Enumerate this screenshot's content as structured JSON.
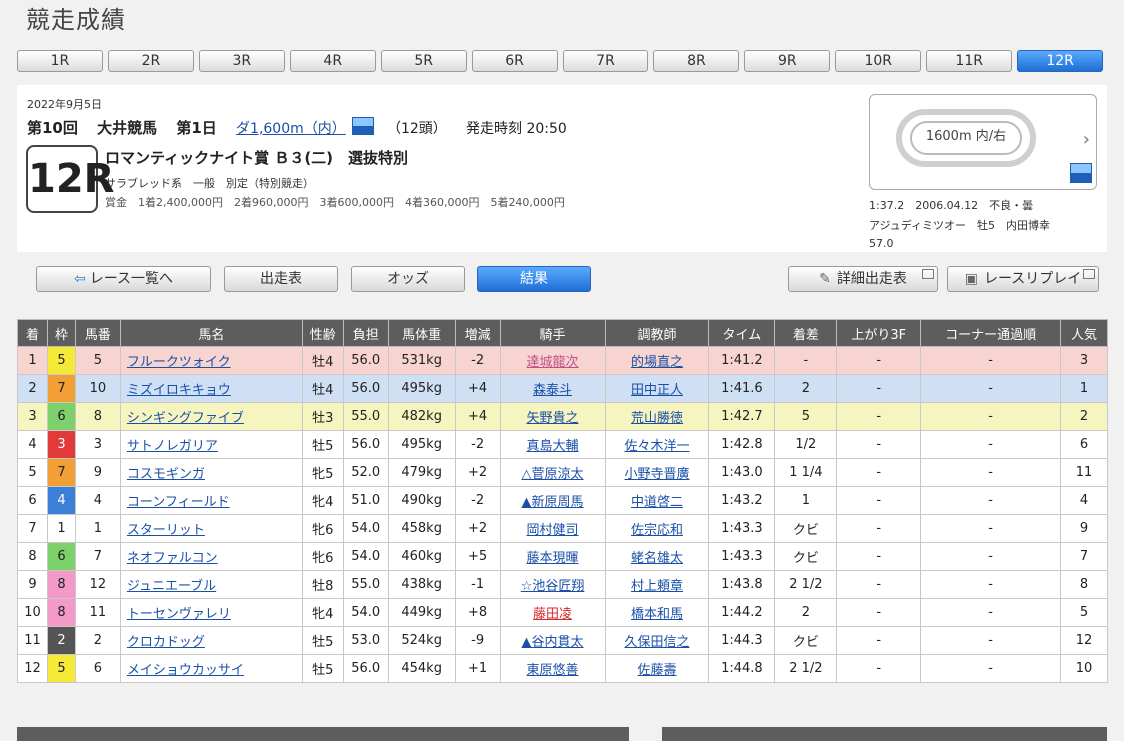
{
  "page": {
    "title": "競走成績"
  },
  "race_tabs": [
    "1R",
    "2R",
    "3R",
    "4R",
    "5R",
    "6R",
    "7R",
    "8R",
    "9R",
    "10R",
    "11R",
    "12R"
  ],
  "active_tab": "12R",
  "race": {
    "date": "2022年9月5日",
    "kai": "第10回",
    "venue": "大井競馬",
    "day": "第1日",
    "distance": "ダ1,600m（内）",
    "heads": "（12頭）",
    "start_time": "発走時刻 20:50",
    "badge": "12R",
    "name": "ロマンティックナイト賞 Ｂ３(二)　選抜特別",
    "conditions": "サラブレッド系　一般　別定（特別競走）",
    "prize": "賞金　1着2,400,000円　2着960,000円　3着600,000円　4着360,000円　5着240,000円"
  },
  "track": {
    "label": "1600m 内/右",
    "record_line1": "1:37.2　2006.04.12　不良・曇",
    "record_line2": "アジュディミツオー　牡5　内田博幸",
    "record_line3": "57.0"
  },
  "buttons": {
    "race_list": "レース一覧へ",
    "entries": "出走表",
    "odds": "オッズ",
    "result": "結果",
    "detail_entries": "詳細出走表",
    "replay": "レースリプレイ"
  },
  "table": {
    "headers": [
      "着",
      "枠",
      "馬番",
      "馬名",
      "性齢",
      "負担",
      "馬体重",
      "増減",
      "騎手",
      "調教師",
      "タイム",
      "着差",
      "上がり3F",
      "コーナー通過順",
      "人気"
    ],
    "rows": [
      {
        "pos": "1",
        "waku": "5",
        "num": "5",
        "horse": "フルークツォイク",
        "sex_age": "牡4",
        "weight": "56.0",
        "body": "531kg",
        "diff": "-2",
        "jockey": "達城龍次",
        "trainer": "的場直之",
        "time": "1:41.2",
        "margin": "-",
        "last3f": "-",
        "corner": "-",
        "pop": "3"
      },
      {
        "pos": "2",
        "waku": "7",
        "num": "10",
        "horse": "ミズイロキキョウ",
        "sex_age": "牡4",
        "weight": "56.0",
        "body": "495kg",
        "diff": "+4",
        "jockey": "森泰斗",
        "trainer": "田中正人",
        "time": "1:41.6",
        "margin": "2",
        "last3f": "-",
        "corner": "-",
        "pop": "1"
      },
      {
        "pos": "3",
        "waku": "6",
        "num": "8",
        "horse": "シンギングファイブ",
        "sex_age": "牡3",
        "weight": "55.0",
        "body": "482kg",
        "diff": "+4",
        "jockey": "矢野貴之",
        "trainer": "荒山勝徳",
        "time": "1:42.7",
        "margin": "5",
        "last3f": "-",
        "corner": "-",
        "pop": "2"
      },
      {
        "pos": "4",
        "waku": "3",
        "num": "3",
        "horse": "サトノレガリア",
        "sex_age": "牡5",
        "weight": "56.0",
        "body": "495kg",
        "diff": "-2",
        "jockey": "真島大輔",
        "trainer": "佐々木洋一",
        "time": "1:42.8",
        "margin": "1/2",
        "last3f": "-",
        "corner": "-",
        "pop": "6"
      },
      {
        "pos": "5",
        "waku": "7",
        "num": "9",
        "horse": "コスモギンガ",
        "sex_age": "牝5",
        "weight": "52.0",
        "body": "479kg",
        "diff": "+2",
        "jockey": "△菅原涼太",
        "trainer": "小野寺晋廣",
        "time": "1:43.0",
        "margin": "1 1/4",
        "last3f": "-",
        "corner": "-",
        "pop": "11"
      },
      {
        "pos": "6",
        "waku": "4",
        "num": "4",
        "horse": "コーンフィールド",
        "sex_age": "牝4",
        "weight": "51.0",
        "body": "490kg",
        "diff": "-2",
        "jockey": "▲新原周馬",
        "trainer": "中道啓二",
        "time": "1:43.2",
        "margin": "1",
        "last3f": "-",
        "corner": "-",
        "pop": "4"
      },
      {
        "pos": "7",
        "waku": "1",
        "num": "1",
        "horse": "スターリット",
        "sex_age": "牝6",
        "weight": "54.0",
        "body": "458kg",
        "diff": "+2",
        "jockey": "岡村健司",
        "trainer": "佐宗応和",
        "time": "1:43.3",
        "margin": "クビ",
        "last3f": "-",
        "corner": "-",
        "pop": "9"
      },
      {
        "pos": "8",
        "waku": "6",
        "num": "7",
        "horse": "ネオファルコン",
        "sex_age": "牝6",
        "weight": "54.0",
        "body": "460kg",
        "diff": "+5",
        "jockey": "藤本現暉",
        "trainer": "蛯名雄太",
        "time": "1:43.3",
        "margin": "クビ",
        "last3f": "-",
        "corner": "-",
        "pop": "7"
      },
      {
        "pos": "9",
        "waku": "8",
        "num": "12",
        "horse": "ジュニエーブル",
        "sex_age": "牡8",
        "weight": "55.0",
        "body": "438kg",
        "diff": "-1",
        "jockey": "☆池谷匠翔",
        "trainer": "村上頼章",
        "time": "1:43.8",
        "margin": "2 1/2",
        "last3f": "-",
        "corner": "-",
        "pop": "8"
      },
      {
        "pos": "10",
        "waku": "8",
        "num": "11",
        "horse": "トーセンヴァレリ",
        "sex_age": "牝4",
        "weight": "54.0",
        "body": "449kg",
        "diff": "+8",
        "jockey": "藤田凌",
        "trainer": "橋本和馬",
        "time": "1:44.2",
        "margin": "2",
        "last3f": "-",
        "corner": "-",
        "pop": "5"
      },
      {
        "pos": "11",
        "waku": "2",
        "num": "2",
        "horse": "クロカドッグ",
        "sex_age": "牡5",
        "weight": "53.0",
        "body": "524kg",
        "diff": "-9",
        "jockey": "▲谷内貫太",
        "trainer": "久保田信之",
        "time": "1:44.3",
        "margin": "クビ",
        "last3f": "-",
        "corner": "-",
        "pop": "12"
      },
      {
        "pos": "12",
        "waku": "5",
        "num": "6",
        "horse": "メイショウカッサイ",
        "sex_age": "牡5",
        "weight": "56.0",
        "body": "454kg",
        "diff": "+1",
        "jockey": "東原悠善",
        "trainer": "佐藤壽",
        "time": "1:44.8",
        "margin": "2 1/2",
        "last3f": "-",
        "corner": "-",
        "pop": "10"
      }
    ]
  },
  "colors": {
    "first_row": "#f8d4d0",
    "second_row": "#cfe0f4",
    "third_row": "#f7f5bf",
    "header_bg": "#5d5d5d",
    "link": "#1a4fa8",
    "active_tab": "#2f7fe0"
  }
}
